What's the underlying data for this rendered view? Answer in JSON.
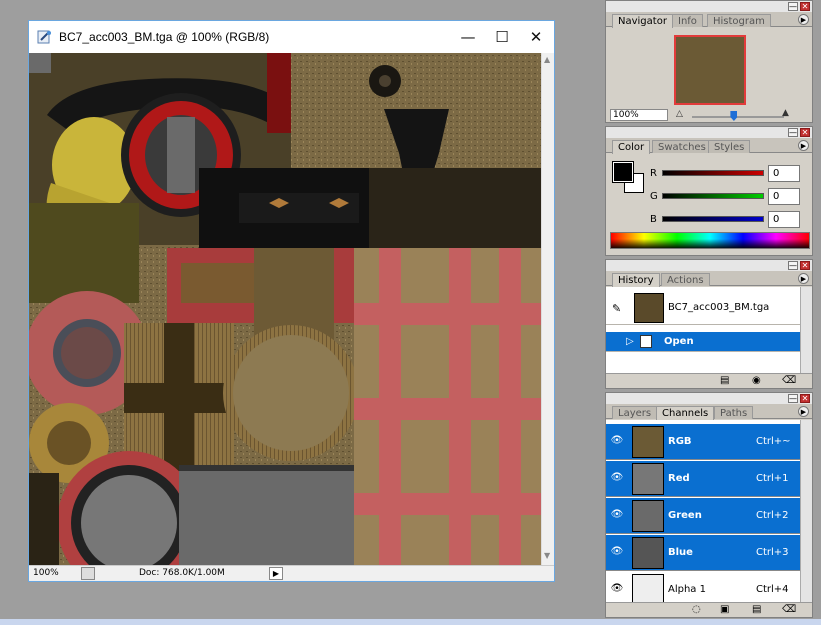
{
  "document": {
    "title": "BC7_acc003_BM.tga @ 100% (RGB/8)",
    "status_zoom": "100%",
    "status_doc": "Doc: 768.0K/1.00M"
  },
  "navigator": {
    "tabs": [
      "Navigator",
      "Info",
      "Histogram"
    ],
    "zoom": "100%",
    "zoom_level": 0.45
  },
  "color": {
    "tabs": [
      "Color",
      "Swatches",
      "Styles"
    ],
    "channels": [
      {
        "label": "R",
        "value": "0",
        "color": "#cc0000"
      },
      {
        "label": "G",
        "value": "0",
        "color": "#00aa00"
      },
      {
        "label": "B",
        "value": "0",
        "color": "#0000cc"
      }
    ],
    "foreground": "#000000",
    "background": "#ffffff"
  },
  "history": {
    "tabs": [
      "History",
      "Actions"
    ],
    "snapshot_label": "BC7_acc003_BM.tga",
    "states": [
      {
        "label": "Open",
        "selected": true
      }
    ]
  },
  "channels_panel": {
    "tabs": [
      "Layers",
      "Channels",
      "Paths"
    ],
    "rows": [
      {
        "name": "RGB",
        "shortcut": "Ctrl+~",
        "selected": true
      },
      {
        "name": "Red",
        "shortcut": "Ctrl+1",
        "selected": true
      },
      {
        "name": "Green",
        "shortcut": "Ctrl+2",
        "selected": true
      },
      {
        "name": "Blue",
        "shortcut": "Ctrl+3",
        "selected": true
      },
      {
        "name": "Alpha 1",
        "shortcut": "Ctrl+4",
        "selected": false
      }
    ]
  },
  "colors": {
    "selection": "#0a6fd0",
    "close": "#c23030"
  }
}
